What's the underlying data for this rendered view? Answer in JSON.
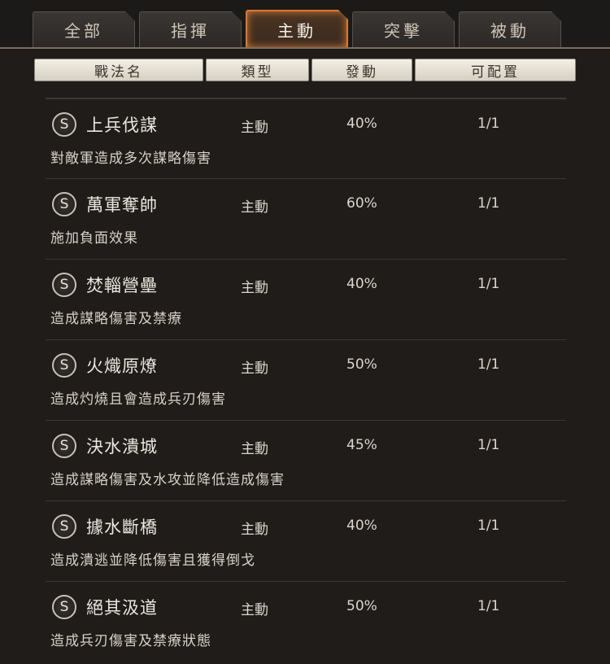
{
  "tabs": [
    "全部",
    "指揮",
    "主動",
    "突擊",
    "被動"
  ],
  "active_tab": "主動",
  "headers": {
    "name": "戰法名",
    "type": "類型",
    "rate": "發動",
    "config": "可配置"
  },
  "tactics": [
    {
      "badge": "S",
      "name": "上兵伐謀",
      "type": "主動",
      "rate": "40%",
      "config": "1/1",
      "desc": "對敵軍造成多次謀略傷害"
    },
    {
      "badge": "S",
      "name": "萬軍奪帥",
      "type": "主動",
      "rate": "60%",
      "config": "1/1",
      "desc": "施加負面效果"
    },
    {
      "badge": "S",
      "name": "焚輜營壘",
      "type": "主動",
      "rate": "40%",
      "config": "1/1",
      "desc": "造成謀略傷害及禁療"
    },
    {
      "badge": "S",
      "name": "火熾原燎",
      "type": "主動",
      "rate": "50%",
      "config": "1/1",
      "desc": "造成灼燒且會造成兵刃傷害"
    },
    {
      "badge": "S",
      "name": "決水潰城",
      "type": "主動",
      "rate": "45%",
      "config": "1/1",
      "desc": "造成謀略傷害及水攻並降低造成傷害"
    },
    {
      "badge": "S",
      "name": "據水斷橋",
      "type": "主動",
      "rate": "40%",
      "config": "1/1",
      "desc": "造成潰逃並降低傷害且獲得倒戈"
    },
    {
      "badge": "S",
      "name": "絕其汲道",
      "type": "主動",
      "rate": "50%",
      "config": "1/1",
      "desc": "造成兵刃傷害及禁療狀態"
    }
  ],
  "colors": {
    "accent": "#d77a34",
    "background": "#1f1c1a",
    "header_bg": "#e8e3d8"
  }
}
